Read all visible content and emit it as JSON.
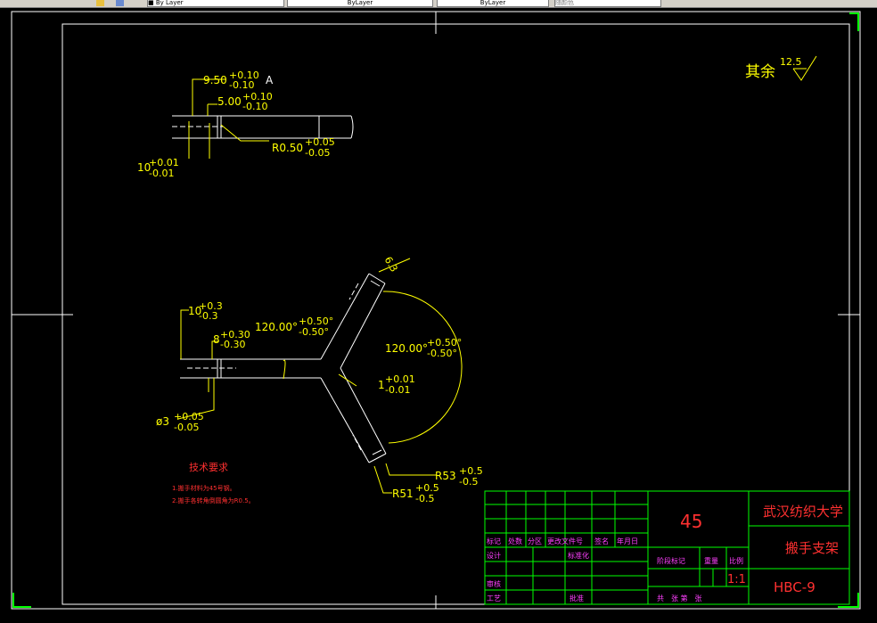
{
  "toolbar": {
    "layer_field": "■ By Layer",
    "linetype_field": "ByLayer",
    "lineweight_field": "ByLayer",
    "color_field": "随颜色"
  },
  "drawing": {
    "finish_note": "其余",
    "finish_value": "12.5",
    "detail_dims": {
      "w950": "9.50",
      "w950_tol_up": "+0.10",
      "w950_tol_dn": "-0.10",
      "view_label": "A",
      "w500": "5.00",
      "w500_tol_up": "+0.10",
      "w500_tol_dn": "-0.10",
      "r050": "R0.50",
      "r050_tol_up": "+0.05",
      "r050_tol_dn": "-0.05",
      "t10": "10",
      "t10_tol_up": "+0.01",
      "t10_tol_dn": "-0.01"
    },
    "main_dims": {
      "d10": "10",
      "d10_tol_up": "+0.3",
      "d10_tol_dn": "-0.3",
      "d8": "8",
      "d8_tol_up": "+0.30",
      "d8_tol_dn": "-0.30",
      "ang1": "120.00°",
      "ang1_tol_up": "+0.50°",
      "ang1_tol_dn": "-0.50°",
      "ang2": "120.00°",
      "ang2_tol_up": "+0.50°",
      "ang2_tol_dn": "-0.50°",
      "t1": "1",
      "t1_tol_up": "+0.01",
      "t1_tol_dn": "-0.01",
      "d3": "ø3",
      "d3_tol_up": "+0.05",
      "d3_tol_dn": "-0.05",
      "d63": "6.3",
      "r53": "R53",
      "r53_tol_up": "+0.5",
      "r53_tol_dn": "-0.5",
      "r51": "R51",
      "r51_tol_up": "+0.5",
      "r51_tol_dn": "-0.5"
    },
    "tech_req": {
      "title": "技术要求",
      "line1": "1.搬手材料为45号钢。",
      "line2": "2.搬手各转角倒圆角为R0.5。"
    },
    "title_block": {
      "material": "45",
      "school": "武汉纺织大学",
      "part_name": "搬手支架",
      "drawing_no": "HBC-9",
      "scale": "1:1",
      "h_mark": "标记",
      "h_qty": "处数",
      "h_zone": "分区",
      "h_doc": "更改文件号",
      "h_sign": "签名",
      "h_date": "年月日",
      "design": "设计",
      "standard": "标准化",
      "stage": "阶段标记",
      "weight": "重量",
      "ratio": "比例",
      "review": "审核",
      "process": "工艺",
      "approve": "批准",
      "sheets": "共　张 第　张"
    }
  }
}
